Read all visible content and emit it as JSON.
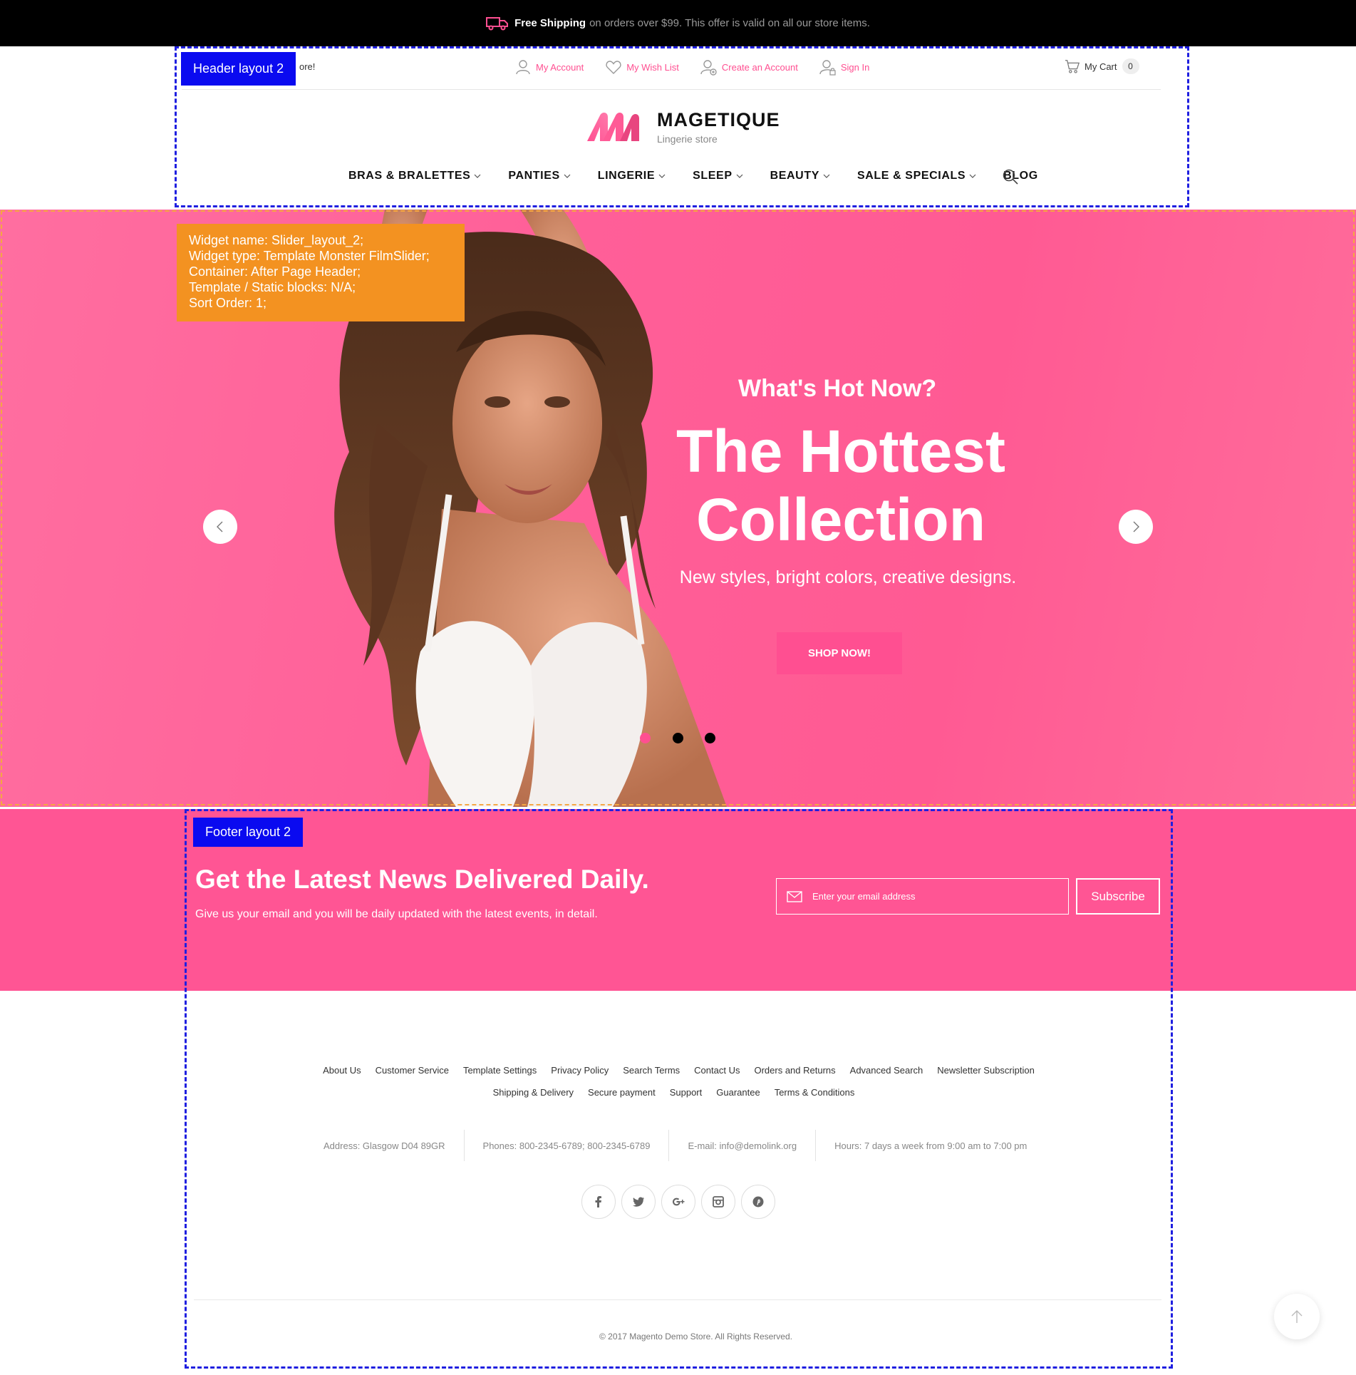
{
  "colors": {
    "accent": "#ff4f91",
    "newsletter_bg": "#ff5594",
    "header_outline": "#1f1fe0",
    "slider_outline": "#f5a742",
    "widget_info_bg": "#f39221"
  },
  "topbar": {
    "free_label": "Free Shipping",
    "message": "on orders over $99. This offer is valid on all our store items.",
    "icon": "truck-icon"
  },
  "header": {
    "layout_label": "Header layout 2",
    "welcome_text": "ore!",
    "links": [
      {
        "label": "My Account",
        "icon": "user-icon"
      },
      {
        "label": "My Wish List",
        "icon": "heart-icon"
      },
      {
        "label": "Create an Account",
        "icon": "user-add-icon"
      },
      {
        "label": "Sign In",
        "icon": "user-lock-icon"
      }
    ],
    "cart": {
      "label": "My Cart",
      "count": "0",
      "icon": "cart-icon"
    },
    "logo": {
      "name": "MAGETIQUE",
      "tagline": "Lingerie store"
    },
    "nav": [
      {
        "label": "BRAS & BRALETTES",
        "dropdown": true
      },
      {
        "label": "PANTIES",
        "dropdown": true
      },
      {
        "label": "LINGERIE",
        "dropdown": true
      },
      {
        "label": "SLEEP",
        "dropdown": true
      },
      {
        "label": "BEAUTY",
        "dropdown": true
      },
      {
        "label": "SALE & SPECIALS",
        "dropdown": true
      },
      {
        "label": "BLOG",
        "dropdown": false
      }
    ]
  },
  "slider": {
    "widget_info": [
      "Widget name: Slider_layout_2;",
      "Widget type: Template Monster FilmSlider;",
      "Container: After Page Header;",
      "Template / Static blocks: N/A;",
      "Sort Order: 1;"
    ],
    "pre_title": "What's Hot Now?",
    "title_line1": "The Hottest",
    "title_line2": "Collection",
    "subtitle": "New styles, bright colors, creative designs.",
    "button": "SHOP NOW!",
    "active_dot": 0,
    "dot_count": 3
  },
  "footer": {
    "layout_label": "Footer layout 2",
    "newsletter": {
      "title": "Get the Latest News Delivered Daily.",
      "subtitle": "Give us your email and you will be daily updated with the latest events, in detail.",
      "placeholder": "Enter your email address",
      "button": "Subscribe"
    },
    "links_row1": [
      "About Us",
      "Customer Service",
      "Template Settings",
      "Privacy Policy",
      "Search Terms",
      "Contact Us",
      "Orders and Returns",
      "Advanced Search",
      "Newsletter Subscription"
    ],
    "links_row2": [
      "Shipping & Delivery",
      "Secure payment",
      "Support",
      "Guarantee",
      "Terms & Conditions"
    ],
    "contacts": {
      "address": "Address: Glasgow D04 89GR",
      "phones": "Phones: 800-2345-6789; 800-2345-6789",
      "email": "E-mail: info@demolink.org",
      "hours": "Hours: 7 days a week from 9:00 am to 7:00 pm"
    },
    "social": [
      "facebook-icon",
      "twitter-icon",
      "google-plus-icon",
      "instagram-icon",
      "pinterest-icon"
    ],
    "copyright": "© 2017 Magento Demo Store. All Rights Reserved."
  }
}
